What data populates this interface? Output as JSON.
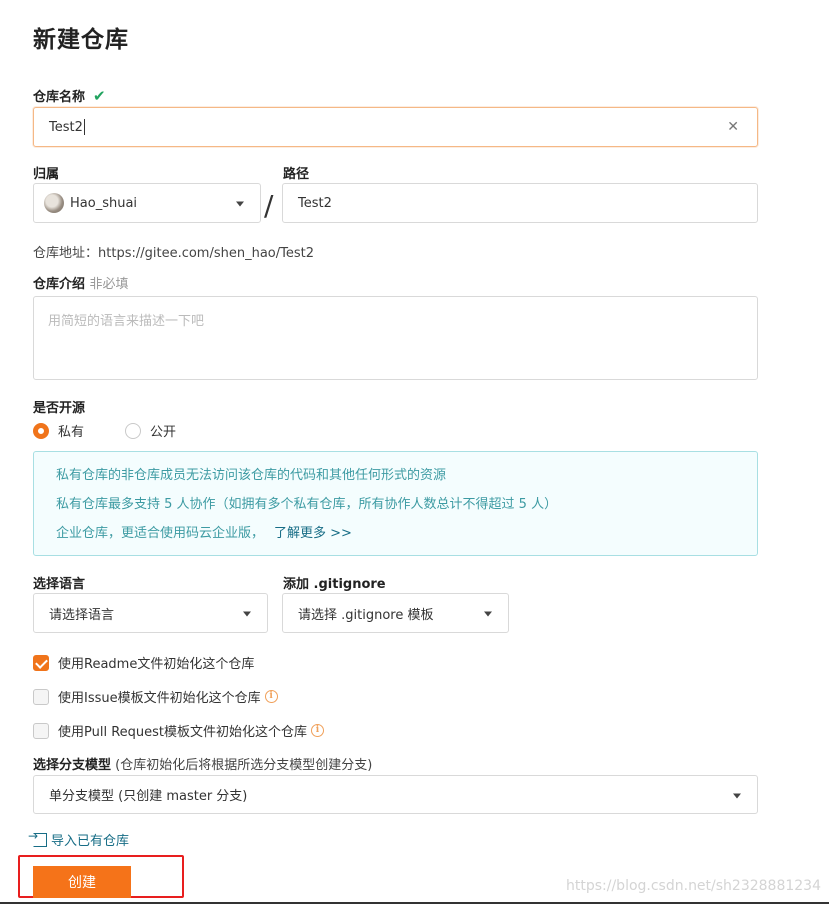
{
  "page_title": "新建仓库",
  "repo_name": {
    "label": "仓库名称",
    "value": "Test2"
  },
  "owner": {
    "label": "归属",
    "value": "Hao_shuai"
  },
  "path": {
    "label": "路径",
    "separator": "/",
    "value": "Test2"
  },
  "repo_url": {
    "label": "仓库地址：",
    "value": "https://gitee.com/shen_hao/Test2"
  },
  "description": {
    "label": "仓库介绍",
    "optional": "非必填",
    "placeholder": "用简短的语言来描述一下吧"
  },
  "visibility": {
    "label": "是否开源",
    "options": [
      {
        "label": "私有",
        "selected": true
      },
      {
        "label": "公开",
        "selected": false
      }
    ]
  },
  "info": {
    "line1": "私有仓库的非仓库成员无法访问该仓库的代码和其他任何形式的资源",
    "line2": "私有仓库最多支持 5 人协作（如拥有多个私有仓库，所有协作人数总计不得超过 5 人）",
    "line3": "企业仓库，更适合使用码云企业版，",
    "line3_link": "了解更多 >>"
  },
  "language": {
    "label": "选择语言",
    "value": "请选择语言"
  },
  "gitignore": {
    "label": "添加 .gitignore",
    "value": "请选择 .gitignore 模板"
  },
  "checkboxes": [
    {
      "label": "使用Readme文件初始化这个仓库",
      "checked": true
    },
    {
      "label": "使用Issue模板文件初始化这个仓库",
      "checked": false
    },
    {
      "label": "使用Pull Request模板文件初始化这个仓库",
      "checked": false
    }
  ],
  "branch_model": {
    "label": "选择分支模型",
    "hint": "(仓库初始化后将根据所选分支模型创建分支)",
    "value": "单分支模型 (只创建 master 分支)"
  },
  "import_link": "导入已有仓库",
  "create_button": "创建",
  "watermark": "https://blog.csdn.net/sh2328881234",
  "colors": {
    "accent": "#f57319",
    "check": "#21a35f",
    "info_bg": "#f4fdfe",
    "info_text": "#3d9ba3",
    "link": "#176d86",
    "highlight_frame": "#e81e1e"
  }
}
